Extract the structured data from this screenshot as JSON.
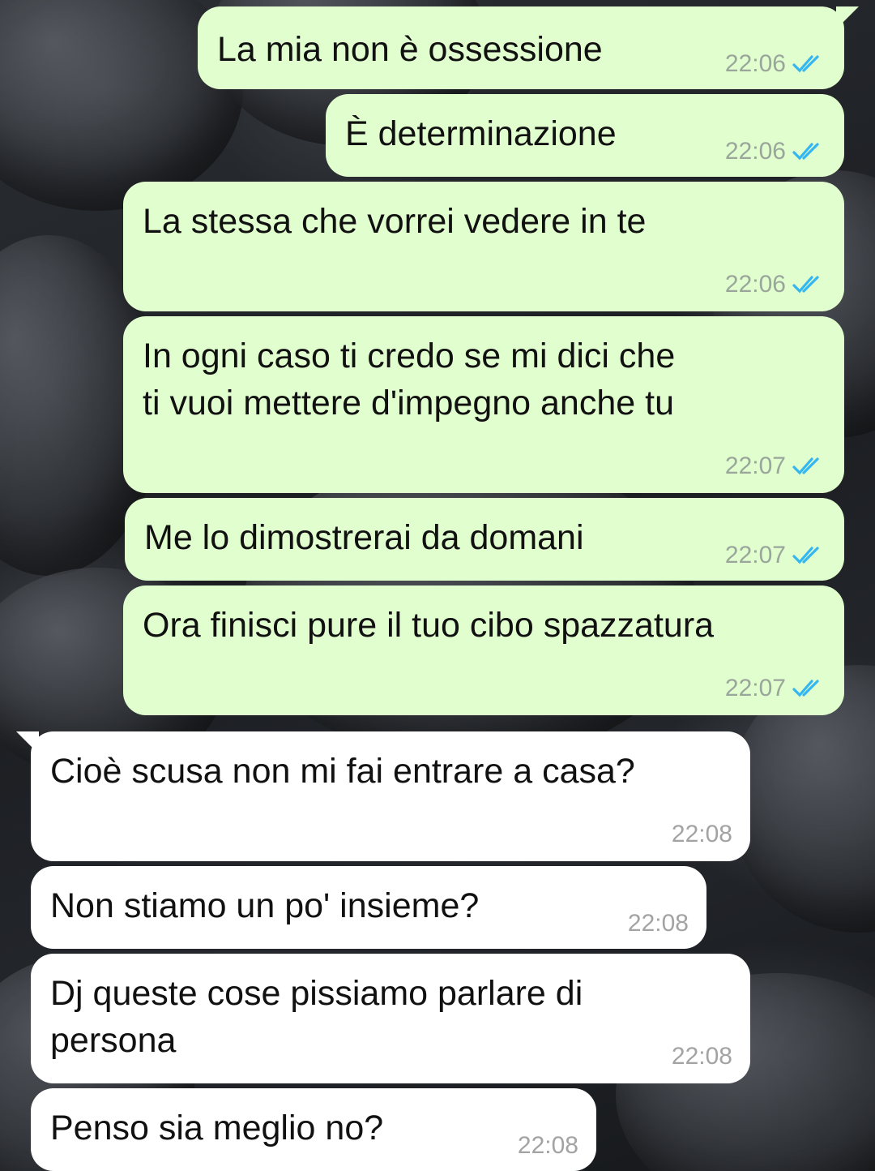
{
  "colors": {
    "outgoing_bubble": "#e1fece",
    "incoming_bubble": "#ffffff",
    "read_ticks": "#34b7f1",
    "time_text": "#9aa59b"
  },
  "messages": [
    {
      "direction": "outgoing",
      "text": "La mia non è ossessione",
      "time": "22:06",
      "status_icon": "double-check-read-icon"
    },
    {
      "direction": "outgoing",
      "text": "È determinazione",
      "time": "22:06",
      "status_icon": "double-check-read-icon"
    },
    {
      "direction": "outgoing",
      "text": "La stessa che vorrei vedere in te",
      "time": "22:06",
      "status_icon": "double-check-read-icon"
    },
    {
      "direction": "outgoing",
      "text": "In ogni caso ti credo se mi dici che\nti vuoi mettere d'impegno anche tu",
      "time": "22:07",
      "status_icon": "double-check-read-icon"
    },
    {
      "direction": "outgoing",
      "text": "Me lo dimostrerai da domani",
      "time": "22:07",
      "status_icon": "double-check-read-icon"
    },
    {
      "direction": "outgoing",
      "text": "Ora finisci pure il tuo cibo spazzatura",
      "time": "22:07",
      "status_icon": "double-check-read-icon"
    },
    {
      "direction": "incoming",
      "text": "Cioè scusa non mi fai entrare a casa?",
      "time": "22:08"
    },
    {
      "direction": "incoming",
      "text": "Non stiamo un po' insieme?",
      "time": "22:08"
    },
    {
      "direction": "incoming",
      "text": "Dj queste cose pissiamo parlare di\npersona",
      "time": "22:08"
    },
    {
      "direction": "incoming",
      "text": "Penso sia meglio no?",
      "time": "22:08"
    }
  ]
}
